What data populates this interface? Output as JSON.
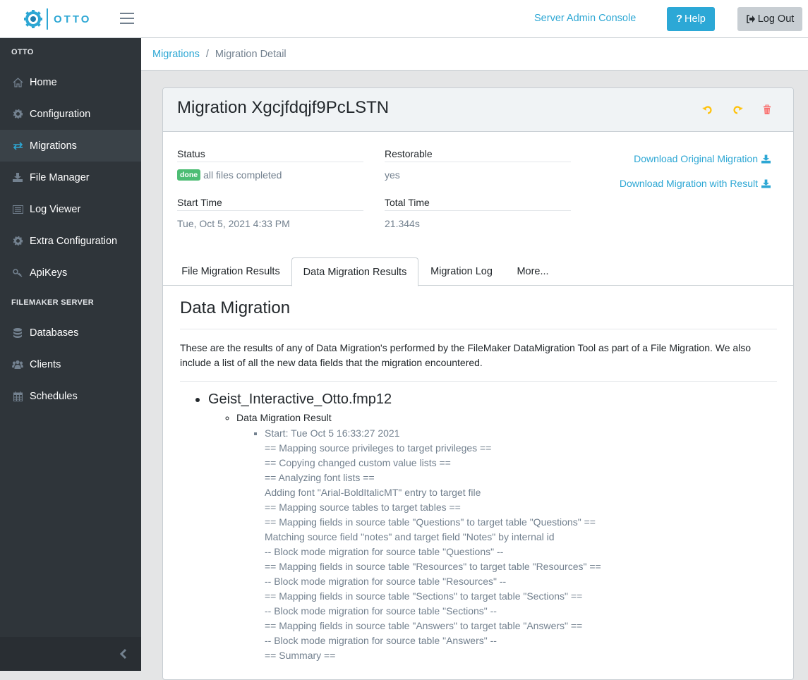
{
  "header": {
    "logo_text": "OTTO",
    "server_admin_console": "Server Admin Console",
    "help_icon": "?",
    "help_label": "Help",
    "logout_label": "Log Out"
  },
  "sidebar": {
    "section_otto": "OTTO",
    "otto_items": [
      {
        "label": "Home",
        "icon": "home-icon"
      },
      {
        "label": "Configuration",
        "icon": "gear-icon"
      },
      {
        "label": "Migrations",
        "icon": "exchange-icon",
        "active": true
      },
      {
        "label": "File Manager",
        "icon": "download-icon"
      },
      {
        "label": "Log Viewer",
        "icon": "list-alt-icon"
      },
      {
        "label": "Extra Configuration",
        "icon": "gear-icon"
      },
      {
        "label": "ApiKeys",
        "icon": "key-icon"
      }
    ],
    "section_filemaker": "FILEMAKER SERVER",
    "filemaker_items": [
      {
        "label": "Databases",
        "icon": "database-icon"
      },
      {
        "label": "Clients",
        "icon": "users-icon"
      },
      {
        "label": "Schedules",
        "icon": "calendar-icon"
      }
    ]
  },
  "breadcrumb": {
    "parent": "Migrations",
    "separator": "/",
    "current": "Migration Detail"
  },
  "migration": {
    "title": "Migration Xgcjfdqjf9PcLSTN",
    "status_label": "Status",
    "status_badge": "done",
    "status_text": "all files completed",
    "restorable_label": "Restorable",
    "restorable_value": "yes",
    "start_time_label": "Start Time",
    "start_time_value": "Tue, Oct 5, 2021 4:33 PM",
    "total_time_label": "Total Time",
    "total_time_value": "21.344s",
    "download_original": "Download Original Migration",
    "download_with_result": "Download Migration with Result"
  },
  "tabs": [
    {
      "label": "File Migration Results"
    },
    {
      "label": "Data Migration Results",
      "active": true
    },
    {
      "label": "Migration Log"
    },
    {
      "label": "More..."
    }
  ],
  "data_migration": {
    "title": "Data Migration",
    "description": "These are the results of any of Data Migration's performed by the FileMaker DataMigration Tool as part of a File Migration. We also include a list of all the new data fields that the migration encountered.",
    "file_name": "Geist_Interactive_Otto.fmp12",
    "result_label": "Data Migration Result",
    "log_lines": [
      "Start: Tue Oct 5 16:33:27 2021",
      "== Mapping source privileges to target privileges ==",
      "== Copying changed custom value lists ==",
      "== Analyzing font lists ==",
      "Adding font \"Arial-BoldItalicMT\" entry to target file",
      "== Mapping source tables to target tables ==",
      "== Mapping fields in source table \"Questions\" to target table \"Questions\" ==",
      "Matching source field \"notes\" and target field \"Notes\" by internal id",
      "-- Block mode migration for source table \"Questions\" --",
      "== Mapping fields in source table \"Resources\" to target table \"Resources\" ==",
      "-- Block mode migration for source table \"Resources\" --",
      "== Mapping fields in source table \"Sections\" to target table \"Sections\" ==",
      "-- Block mode migration for source table \"Sections\" --",
      "== Mapping fields in source table \"Answers\" to target table \"Answers\" ==",
      "-- Block mode migration for source table \"Answers\" --",
      "== Summary =="
    ]
  },
  "colors": {
    "brand": "#2da7d4",
    "sidebar_bg": "#2f353a",
    "badge_success": "#4dbd74",
    "warning": "#ffc107",
    "danger": "#f86c6b"
  }
}
